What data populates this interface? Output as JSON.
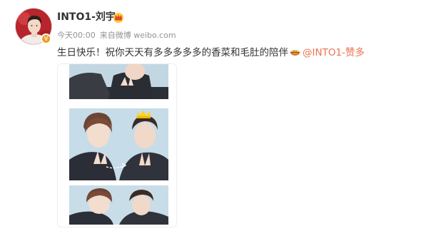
{
  "post": {
    "author": "INTO1-刘宇",
    "time": "今天00:00",
    "source_prefix": "来自",
    "source": "微博 weibo.com",
    "text": "生日快乐！祝你天天有多多多多多的香菜和毛肚的陪伴",
    "mention": "@INTO1-赞多",
    "verified_badge": "V"
  },
  "icons": {
    "avatar": "avatar",
    "verified": "verified-icon",
    "badge": "crown-badge-icon",
    "emoji": "hotpot-emoji-icon"
  },
  "colors": {
    "mention": "#eb7350",
    "text": "#333333",
    "meta": "#939393",
    "verified": "#f39b1e"
  }
}
